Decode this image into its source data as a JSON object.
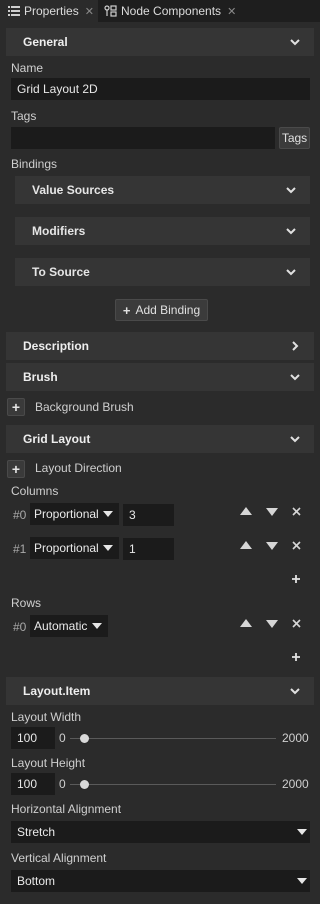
{
  "tabs": [
    {
      "label": "Properties",
      "icon": "list-icon"
    },
    {
      "label": "Node Components",
      "icon": "components-icon"
    }
  ],
  "general": {
    "title": "General",
    "name_label": "Name",
    "name_value": "Grid Layout 2D",
    "tags_label": "Tags",
    "tags_value": "",
    "tags_button": "Tags",
    "bindings_label": "Bindings",
    "bindings_groups": [
      "Value Sources",
      "Modifiers",
      "To Source"
    ],
    "add_binding": "Add Binding"
  },
  "description": {
    "title": "Description"
  },
  "brush": {
    "title": "Brush",
    "item": "Background Brush"
  },
  "grid_layout": {
    "title": "Grid Layout",
    "layout_direction": "Layout Direction",
    "columns_label": "Columns",
    "columns": [
      {
        "index": "#0",
        "type": "Proportional",
        "value": "3"
      },
      {
        "index": "#1",
        "type": "Proportional",
        "value": "1"
      }
    ],
    "rows_label": "Rows",
    "rows": [
      {
        "index": "#0",
        "type": "Automatic"
      }
    ]
  },
  "layout_item": {
    "title": "Layout.Item",
    "width_label": "Layout Width",
    "width_value": "100",
    "width_min": "0",
    "width_max": "2000",
    "width_level": 0.0,
    "height_label": "Layout Height",
    "height_value": "100",
    "height_min": "0",
    "height_max": "2000",
    "height_level": 0.0,
    "h_align_label": "Horizontal Alignment",
    "h_align_value": "Stretch",
    "v_align_label": "Vertical Alignment",
    "v_align_value": "Bottom"
  },
  "colors": {
    "panel": "#2b2b2b",
    "header": "#353535",
    "field": "#1b1b1b",
    "tabbar": "#1e1e1e"
  }
}
